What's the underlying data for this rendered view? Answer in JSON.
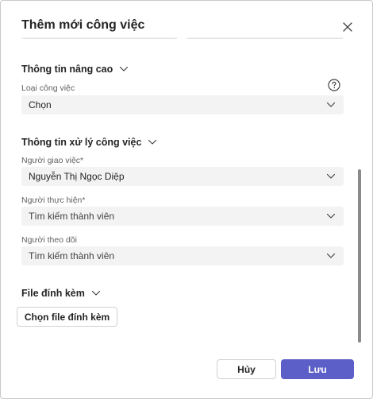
{
  "dialog": {
    "title": "Thêm mới công việc",
    "close_icon": "close-icon"
  },
  "advanced": {
    "header": "Thông tin nâng cao",
    "task_type": {
      "label": "Loại công việc",
      "value": "Chọn"
    },
    "help_icon": "question-circle-icon"
  },
  "processing": {
    "header": "Thông tin xử lý công việc",
    "assigner": {
      "label": "Người giao việc*",
      "value": "Nguyễn Thị Ngọc Diệp"
    },
    "assignee": {
      "label": "Người thực hiện*",
      "placeholder": "Tìm kiếm thành viên"
    },
    "follower": {
      "label": "Người theo dõi",
      "placeholder": "Tìm kiếm thành viên"
    }
  },
  "attachments": {
    "header": "File đính kèm",
    "button": "Chọn file đính kèm"
  },
  "footer": {
    "cancel": "Hủy",
    "save": "Lưu"
  },
  "colors": {
    "accent": "#5b5fc7",
    "field_bg": "#f3f3f3"
  }
}
